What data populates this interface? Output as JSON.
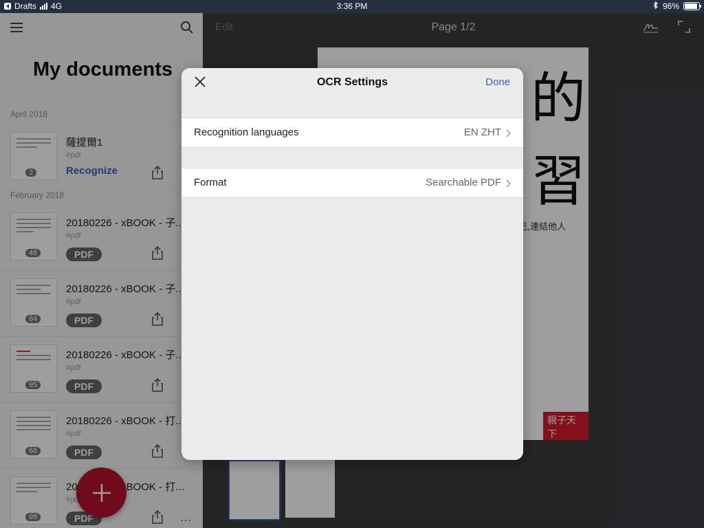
{
  "statusbar": {
    "back_app": "Drafts",
    "network": "4G",
    "time": "3:36 PM",
    "battery": "96%"
  },
  "left_panel": {
    "title": "My documents",
    "sections": [
      {
        "label": "April 2018"
      },
      {
        "label": "February 2018"
      }
    ],
    "documents": [
      {
        "name": "薩提爾1",
        "tag": "#pdf",
        "pages": "2",
        "action": "Recognize"
      },
      {
        "name": "20180226 - xBOOK - 子...",
        "tag": "#pdf",
        "pages": "48",
        "action": "PDF"
      },
      {
        "name": "20180226 - xBOOK - 子...",
        "tag": "#pdf",
        "pages": "84",
        "action": "PDF"
      },
      {
        "name": "20180226 - xBOOK - 子...",
        "tag": "#pdf",
        "pages": "95",
        "action": "PDF"
      },
      {
        "name": "20180226 - xBOOK - 打...",
        "tag": "#pdf",
        "pages": "68",
        "action": "PDF"
      },
      {
        "name": "20180226 - xBOOK - 打...",
        "tag": "#pdf",
        "pages": "98",
        "action": "PDF"
      }
    ]
  },
  "viewer": {
    "edit_label": "Edit",
    "page_indicator": "Page 1/2",
    "page_text": {
      "char1": "的",
      "char2": "習",
      "line": "己,連結他人",
      "logo": "親子天下"
    }
  },
  "modal": {
    "title": "OCR Settings",
    "done_label": "Done",
    "rows": [
      {
        "label": "Recognition languages",
        "value": "EN ZHT"
      },
      {
        "label": "Format",
        "value": "Searchable PDF"
      }
    ]
  },
  "colors": {
    "accent": "#3b5fc0",
    "fab": "#b5122e",
    "statusbar": "#243040"
  }
}
